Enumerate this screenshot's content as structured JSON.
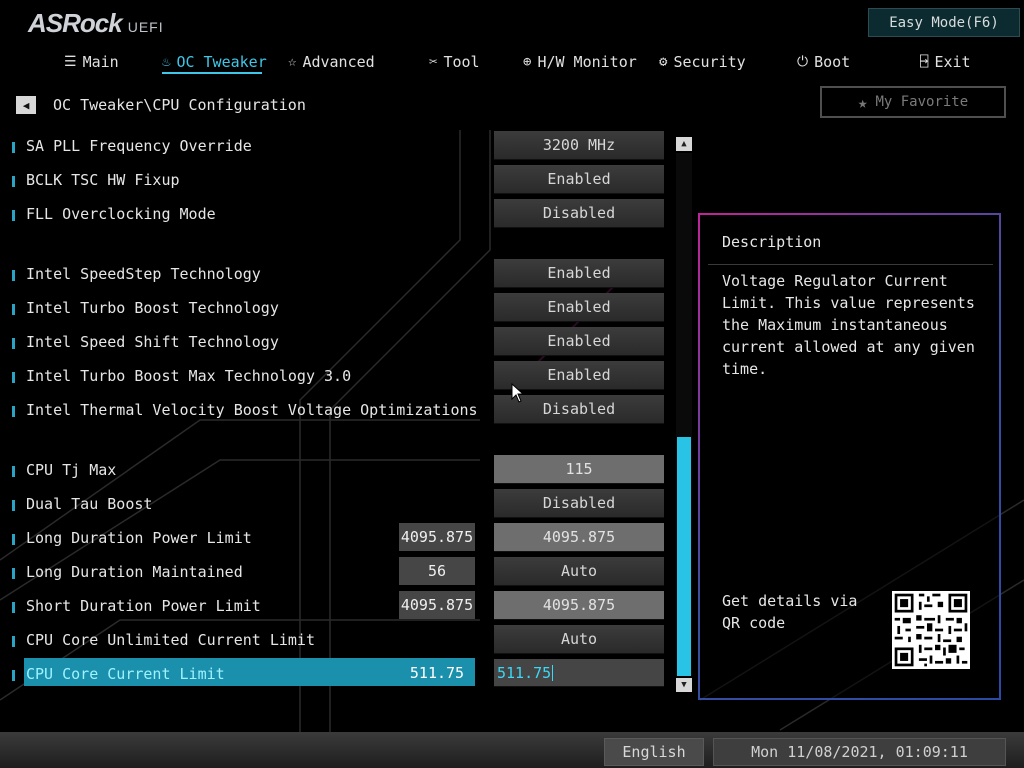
{
  "header": {
    "brand": "ASRock",
    "brand_suffix": "UEFI",
    "easy_mode_label": "Easy Mode(F6)"
  },
  "nav": {
    "tabs": [
      {
        "label": "Main",
        "icon": "list-icon"
      },
      {
        "label": "OC Tweaker",
        "icon": "flame-icon",
        "active": true
      },
      {
        "label": "Advanced",
        "icon": "star-outline-icon"
      },
      {
        "label": "Tool",
        "icon": "tools-icon"
      },
      {
        "label": "H/W Monitor",
        "icon": "crosshair-icon"
      },
      {
        "label": "Security",
        "icon": "shield-gear-icon"
      },
      {
        "label": "Boot",
        "icon": "power-icon"
      },
      {
        "label": "Exit",
        "icon": "exit-door-icon"
      }
    ]
  },
  "breadcrumb": "OC Tweaker\\CPU Configuration",
  "favorite_label": "My Favorite",
  "settings": [
    {
      "label": "SA PLL Frequency Override",
      "value": "3200 MHz"
    },
    {
      "label": "BCLK TSC HW Fixup",
      "value": "Enabled"
    },
    {
      "label": "FLL Overclocking Mode",
      "value": "Disabled"
    },
    {
      "label": "Intel SpeedStep Technology",
      "value": "Enabled"
    },
    {
      "label": "Intel Turbo Boost Technology",
      "value": "Enabled"
    },
    {
      "label": "Intel Speed Shift Technology",
      "value": "Enabled"
    },
    {
      "label": "Intel Turbo Boost Max Technology 3.0",
      "value": "Enabled"
    },
    {
      "label": "Intel Thermal Velocity Boost Voltage Optimizations",
      "value": "Disabled"
    },
    {
      "label": "CPU Tj Max",
      "value": "115"
    },
    {
      "label": "Dual Tau Boost",
      "value": "Disabled"
    },
    {
      "label": "Long Duration Power Limit",
      "readout": "4095.875",
      "value": "4095.875"
    },
    {
      "label": "Long Duration Maintained",
      "readout": "56",
      "value": "Auto"
    },
    {
      "label": "Short Duration Power Limit",
      "readout": "4095.875",
      "value": "4095.875"
    },
    {
      "label": "CPU Core Unlimited Current Limit",
      "value": "Auto"
    },
    {
      "label": "CPU Core Current Limit",
      "readout": "511.75",
      "value": "511.75",
      "selected": true
    }
  ],
  "description": {
    "title": "Description",
    "text": "Voltage Regulator Current Limit. This value represents the Maximum instantaneous current allowed at any given time.",
    "qr_text": "Get details via QR code"
  },
  "footer": {
    "language": "English",
    "datetime": "Mon 11/08/2021, 01:09:11"
  },
  "scrollbar": {
    "position_fraction": 0.55,
    "visible_fraction": 0.45
  },
  "colors": {
    "accent": "#29c3e6",
    "selected_row": "#1a90ad",
    "panel_border_pink": "#c0249a",
    "panel_border_blue": "#2a4aa8"
  }
}
